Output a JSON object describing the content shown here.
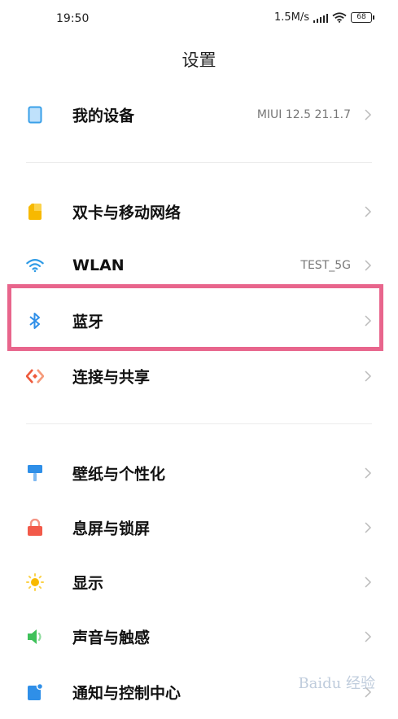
{
  "status_bar": {
    "time": "19:50",
    "network_speed": "1.5M/s",
    "battery": "68"
  },
  "header": {
    "title": "设置"
  },
  "items": [
    {
      "id": "my-device",
      "label": "我的设备",
      "value": "MIUI 12.5 21.1.7",
      "icon": "phone-device-icon",
      "color": "#3aa0e8"
    },
    {
      "id": "sim-network",
      "label": "双卡与移动网络",
      "value": "",
      "icon": "sim-card-icon",
      "color": "#f5b800"
    },
    {
      "id": "wlan",
      "label": "WLAN",
      "value": "TEST_5G",
      "icon": "wifi-icon",
      "color": "#2f9be6"
    },
    {
      "id": "bluetooth",
      "label": "蓝牙",
      "value": "",
      "icon": "bluetooth-icon",
      "color": "#2f8fe8"
    },
    {
      "id": "connection-sharing",
      "label": "连接与共享",
      "value": "",
      "icon": "connection-share-icon",
      "color": "#ee5a3c"
    },
    {
      "id": "wallpaper",
      "label": "壁纸与个性化",
      "value": "",
      "icon": "paint-roller-icon",
      "color": "#2f8fe8"
    },
    {
      "id": "lock-screen",
      "label": "息屏与锁屏",
      "value": "",
      "icon": "lock-icon",
      "color": "#f25a4a"
    },
    {
      "id": "display",
      "label": "显示",
      "value": "",
      "icon": "sun-icon",
      "color": "#f8b900"
    },
    {
      "id": "sound",
      "label": "声音与触感",
      "value": "",
      "icon": "speaker-icon",
      "color": "#3fc15a"
    },
    {
      "id": "notifications",
      "label": "通知与控制中心",
      "value": "",
      "icon": "notification-icon",
      "color": "#2f8fe8"
    }
  ],
  "watermark": "Baidu 经验"
}
